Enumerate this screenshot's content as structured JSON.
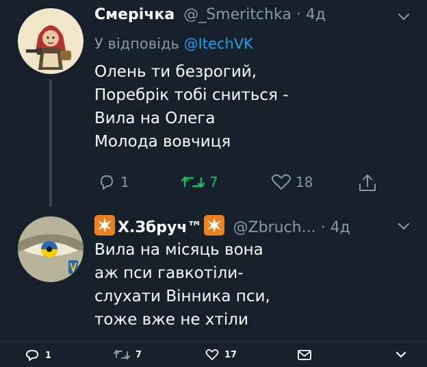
{
  "tweet1": {
    "display_name": "Смерічка",
    "handle": "@_Smeritchka",
    "separator": "·",
    "time": "4д",
    "reply_prefix": "У відповідь",
    "reply_mention": "@ItechVK",
    "lines": [
      "Олень ти безрогий,",
      "Поребрік тобі сниться -",
      "Вила на Олега",
      "Молода вовчиця"
    ],
    "replies": "1",
    "retweets": "7",
    "likes": "18",
    "avatar_icon": "cartoon-woman-with-gun-avatar"
  },
  "tweet2": {
    "display_name": "Х.Збруч™",
    "handle": "@Zbruch...",
    "separator": "·",
    "time": "4д",
    "lines": [
      "Вила на місяць вона",
      "аж пси гавкотіли-",
      "слухати Вінника пси,",
      "тоже вже не хтіли"
    ],
    "avatar_icon": "eye-with-ukrainian-flag-avatar"
  },
  "bottom_bar": {
    "replies": "1",
    "retweets": "7",
    "likes": "17"
  },
  "colors": {
    "background": "#15202b",
    "muted": "#8899a6",
    "link": "#1da1f2",
    "retweet": "#17bf63",
    "badge": "#e8821e"
  }
}
